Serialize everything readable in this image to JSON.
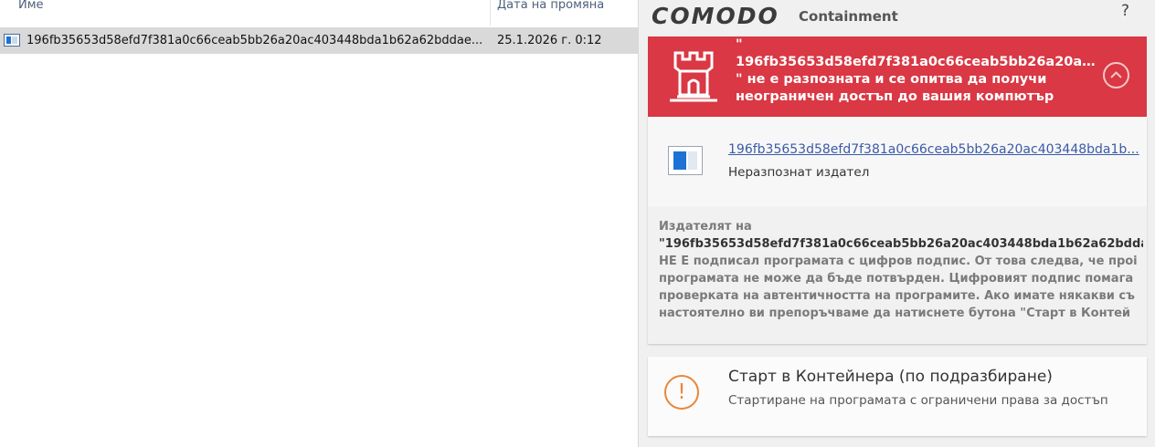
{
  "explorer": {
    "columns": {
      "name": "Име",
      "date": "Дата на промяна"
    },
    "file": {
      "name": "196fb35653d58efd7f381a0c66ceab5bb26a20ac403448bda1b62a62bddae...",
      "date": "25.1.2026 г. 0:12"
    }
  },
  "comodo": {
    "brand": "COMODO",
    "subtitle": "Containment",
    "help": "?",
    "alert": {
      "line1": "\"",
      "line2": "196fb35653d58efd7f381a0c66ceab5bb26a20ac...",
      "line3": "\" не е разпозната и се опитва да получи",
      "line4": "неограничен достъп до вашия компютър"
    },
    "file_card": {
      "link": "196fb35653d58efd7f381a0c66ceab5bb26a20ac403448bda1b...",
      "publisher": "Неразпознат издател"
    },
    "description": {
      "line1": "Издателят на",
      "line2": "\"196fb35653d58efd7f381a0c66ceab5bb26a20ac403448bda1b62a62bddae",
      "line3": "НЕ Е подписал програмата с цифров подпис. От това следва, че проi",
      "line4": "програмата не може да бъде потвърден. Цифровият подпис помага",
      "line5": "проверката на автентичността на програмите. Ако имате някакви съ",
      "line6": "настоятелно ви препоръчваме да натиснете бутона \"Старт в Контей"
    },
    "action": {
      "title": "Старт в Контейнера (по подразбиране)",
      "desc": "Стартиране на програмата с ограничени права за достъп",
      "icon": "!"
    },
    "colors": {
      "alert_bg": "#d93844",
      "link": "#3b5ba8",
      "warning": "#e8873a"
    }
  }
}
